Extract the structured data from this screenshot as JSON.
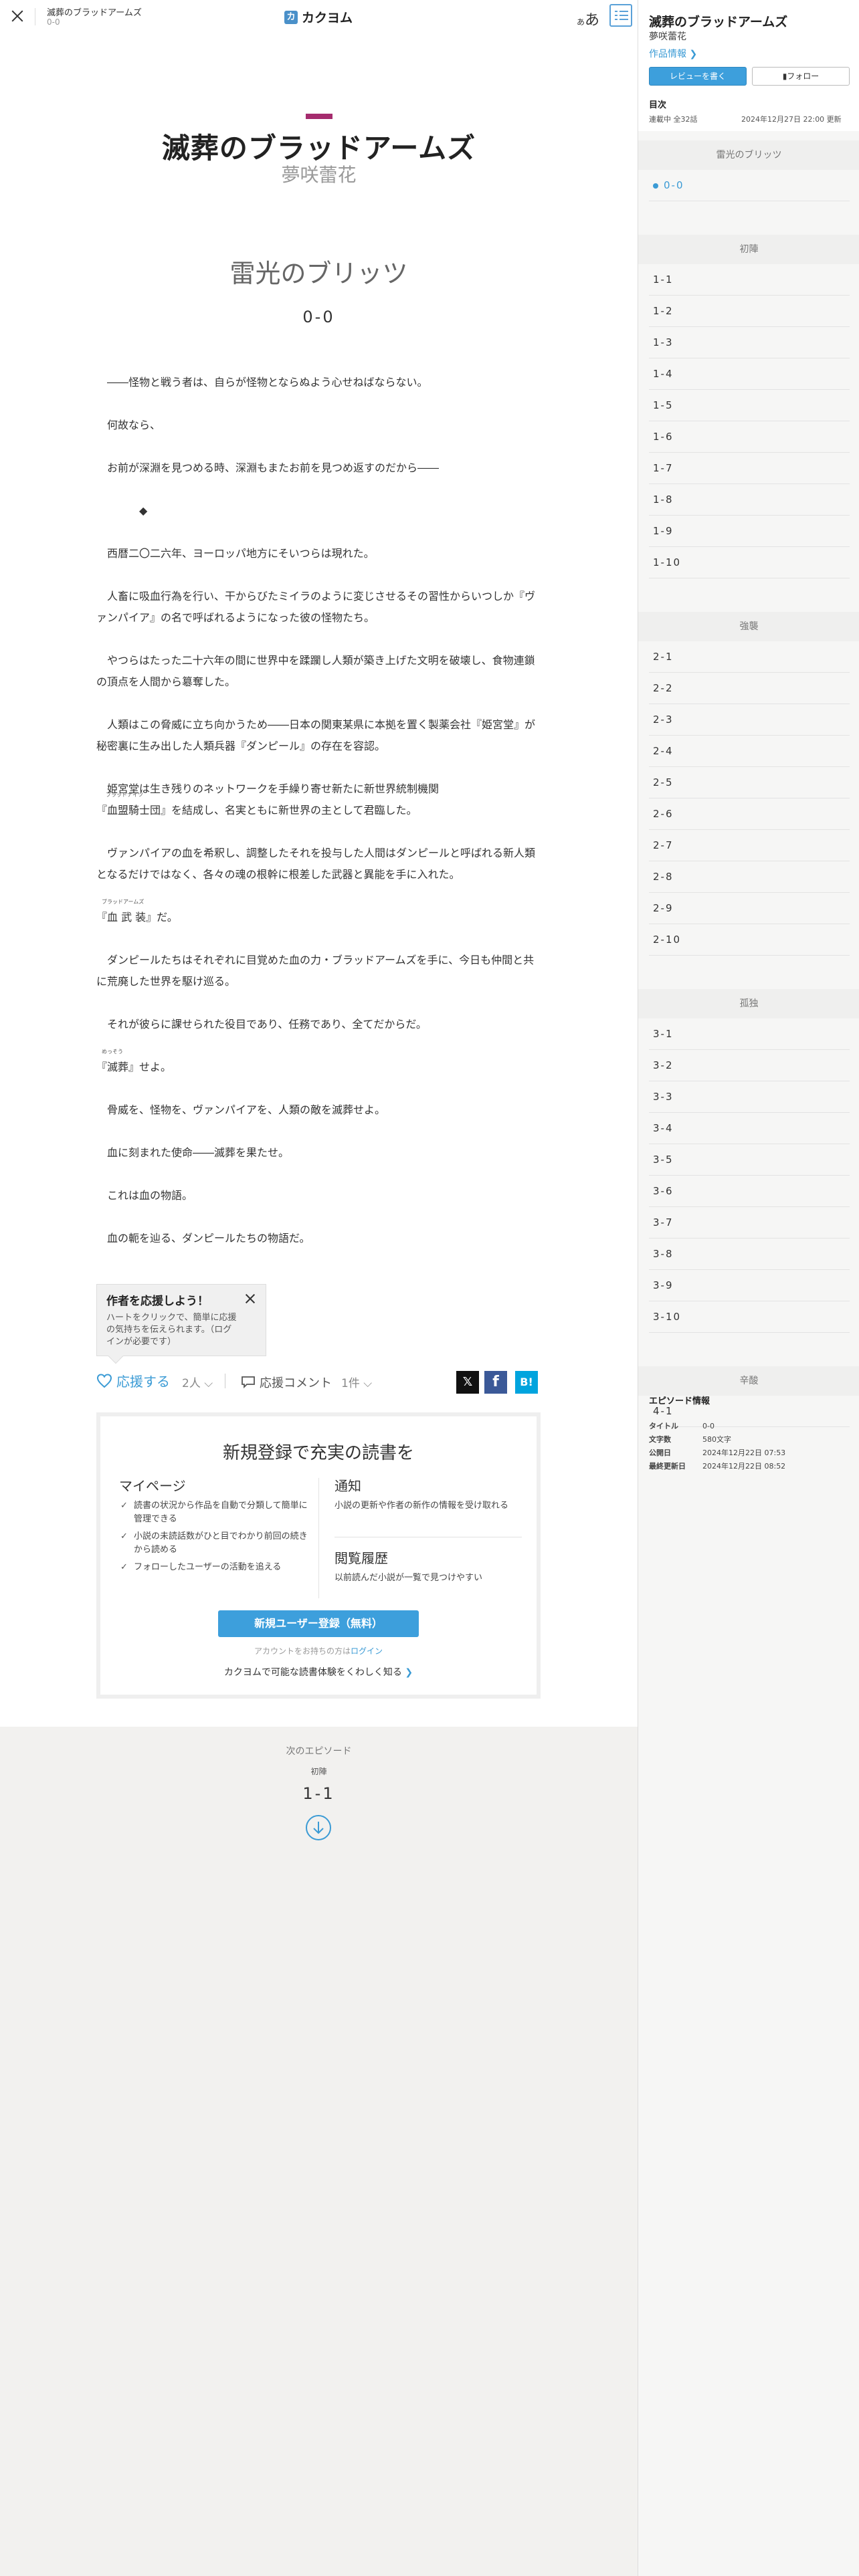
{
  "topbar": {
    "work_title": "滅葬のブラッドアームズ",
    "episode": "0-0",
    "logo_mark": "カ",
    "logo_text": "カクヨム",
    "font_small": "あ",
    "font_large": "あ"
  },
  "header": {
    "work_title": "滅葬のブラッドアームズ",
    "author": "夢咲蕾花",
    "chapter_title": "雷光のブリッツ",
    "episode_title": "0-0"
  },
  "body": [
    "――怪物と戦う者は、自らが怪物とならぬよう心せねばならない。",
    "",
    "何故なら、",
    "",
    "お前が深淵を見つめる時、深淵もまたお前を見つめ返すのだから――",
    "",
    "　　　　◆",
    "",
    "西暦二〇二六年、ヨーロッパ地方にそいつらは現れた。",
    "",
    "人畜に吸血行為を行い、干からびたミイラのように変じさせるその習性からいつしか『ヴァンパイア』の名で呼ばれるようになった彼の怪物たち。",
    "",
    "やつらはたった二十六年の間に世界中を蹂躙し人類が築き上げた文明を破壊し、食物連鎖の頂点を人間から簒奪した。",
    "",
    "人類はこの脅威に立ち向かうため――日本の関東某県に本拠を置く製薬会社『姫宮堂』が秘密裏に生み出した人類兵器『ダンピール』の存在を容認。",
    "",
    "姫宮堂は生き残りのネットワークを手繰り寄せ新たに新世界統制機関",
    "RUBY1",
    "",
    "ヴァンパイアの血を希釈し、調整したそれを投与した人間はダンピールと呼ばれる新人類となるだけではなく、各々の魂の根幹に根差した武器と異能を手に入れた。",
    "",
    "RUBY2",
    "",
    "ダンピールたちはそれぞれに目覚めた血の力・ブラッドアームズを手に、今日も仲間と共に荒廃した世界を駆け巡る。",
    "",
    "それが彼らに課せられた役目であり、任務であり、全てだからだ。",
    "",
    "RUBY3",
    "",
    "骨威を、怪物を、ヴァンパイアを、人類の敵を滅葬せよ。",
    "",
    "血に刻まれた使命――滅葬を果たせ。",
    "",
    "これは血の物語。",
    "",
    "血の軛を辿る、ダンピールたちの物語だ。"
  ],
  "ruby": {
    "r1_base": "『血盟騎士団』を結成し、名実ともに新世界の主として君臨した。",
    "r1_rt": "ブラッドナイツ",
    "r2_base": "『血 武 装』だ。",
    "r2_rt": "ブラッドアームズ",
    "r3_base": "『滅葬』せよ。",
    "r3_rt": "めっそう"
  },
  "cheer_popup": {
    "title": "作者を応援しよう！",
    "text": "ハートをクリックで、簡単に応援の気持ちを伝えられます。（ログインが必要です）"
  },
  "actions": {
    "cheer_label": "応援する",
    "cheer_count": "2人",
    "comment_label": "応援コメント",
    "comment_count": "1件",
    "share_x": "𝕏",
    "share_fb": "f",
    "share_hatena": "B!"
  },
  "signup": {
    "title": "新規登録で充実の読書を",
    "mypage_heading": "マイページ",
    "mypage_items": [
      "読書の状況から作品を自動で分類して簡単に管理できる",
      "小説の未読話数がひと目でわかり前回の続きから読める",
      "フォローしたユーザーの活動を追える"
    ],
    "notify_heading": "通知",
    "notify_text": "小説の更新や作者の新作の情報を受け取れる",
    "history_heading": "閲覧履歴",
    "history_text": "以前読んだ小説が一覧で見つけやすい",
    "register_label": "新規ユーザー登録（無料）",
    "login_prefix": "アカウントをお持ちの方は",
    "login_link": "ログイン",
    "learn_more": "カクヨムで可能な読書体験をくわしく知る",
    "learn_more_chev": "❯"
  },
  "next_episode": {
    "label": "次のエピソード",
    "chapter": "初陣",
    "title": "1-1"
  },
  "sidebar": {
    "title": "滅葬のブラッドアームズ",
    "author": "夢咲蕾花",
    "work_info": "作品情報 ❯",
    "review_btn": "レビューを書く",
    "follow_btn": "フォロー",
    "toc_label": "目次",
    "status": "連載中 全32話",
    "updated": "2024年12月27日 22:00 更新",
    "chapters": [
      {
        "name": "雷光のブリッツ",
        "episodes": [
          "0-0"
        ]
      },
      {
        "name": "初陣",
        "episodes": [
          "1-1",
          "1-2",
          "1-3",
          "1-4",
          "1-5",
          "1-6",
          "1-7",
          "1-8",
          "1-9",
          "1-10"
        ]
      },
      {
        "name": "強襲",
        "episodes": [
          "2-1",
          "2-2",
          "2-3",
          "2-4",
          "2-5",
          "2-6",
          "2-7",
          "2-8",
          "2-9",
          "2-10"
        ]
      },
      {
        "name": "孤独",
        "episodes": [
          "3-1",
          "3-2",
          "3-3",
          "3-4",
          "3-5",
          "3-6",
          "3-7",
          "3-8",
          "3-9",
          "3-10"
        ]
      },
      {
        "name": "辛酸",
        "episodes": [
          "4-1"
        ]
      }
    ],
    "info": {
      "title": "エピソード情報",
      "rows": [
        {
          "key": "タイトル",
          "value": "0-0"
        },
        {
          "key": "文字数",
          "value": "580文字"
        },
        {
          "key": "公開日",
          "value": "2024年12月22日 07:53"
        },
        {
          "key": "最終更新日",
          "value": "2024年12月22日 08:52"
        }
      ]
    }
  },
  "colors": {
    "accent": "#3b9bd5",
    "title_accent": "#a52c6e"
  }
}
